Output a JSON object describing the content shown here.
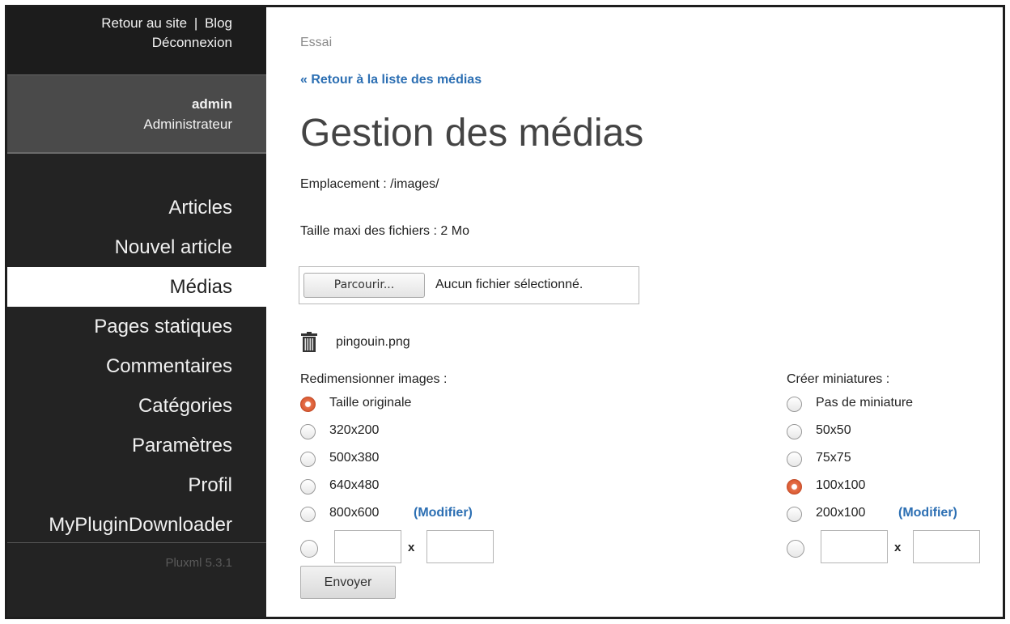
{
  "topbar": {
    "back_to_site": "Retour au site",
    "separator": "|",
    "blog": "Blog",
    "logout": "Déconnexion"
  },
  "user": {
    "name": "admin",
    "role": "Administrateur"
  },
  "menu": [
    {
      "label": "Articles",
      "active": false
    },
    {
      "label": "Nouvel article",
      "active": false
    },
    {
      "label": "Médias",
      "active": true
    },
    {
      "label": "Pages statiques",
      "active": false
    },
    {
      "label": "Commentaires",
      "active": false
    },
    {
      "label": "Catégories",
      "active": false
    },
    {
      "label": "Paramètres",
      "active": false
    },
    {
      "label": "Profil",
      "active": false
    },
    {
      "label": "MyPluginDownloader",
      "active": false
    }
  ],
  "version": "Pluxml 5.3.1",
  "main": {
    "site_name": "Essai",
    "back_link": "« Retour à la liste des médias",
    "title": "Gestion des médias",
    "location": "Emplacement : /images/",
    "max_size": "Taille maxi des fichiers : 2 Mo",
    "browse_label": "Parcourir...",
    "no_file": "Aucun fichier sélectionné.",
    "file_name": "pingouin.png",
    "submit_label": "Envoyer",
    "x_separator": "x"
  },
  "resize": {
    "label": "Redimensionner images :",
    "options": [
      "Taille originale",
      "320x200",
      "500x380",
      "640x480",
      "800x600"
    ],
    "selected_index": 0,
    "modify_label": "(Modifier)"
  },
  "thumbs": {
    "label": "Créer miniatures :",
    "options": [
      "Pas de miniature",
      "50x50",
      "75x75",
      "100x100",
      "200x100"
    ],
    "selected_index": 3,
    "modify_label": "(Modifier)"
  },
  "colors": {
    "sidebar_bg": "#232323",
    "userbox_bg": "#4a4a4a",
    "link": "#2c6fb3",
    "radio_checked": "#e5704b"
  }
}
